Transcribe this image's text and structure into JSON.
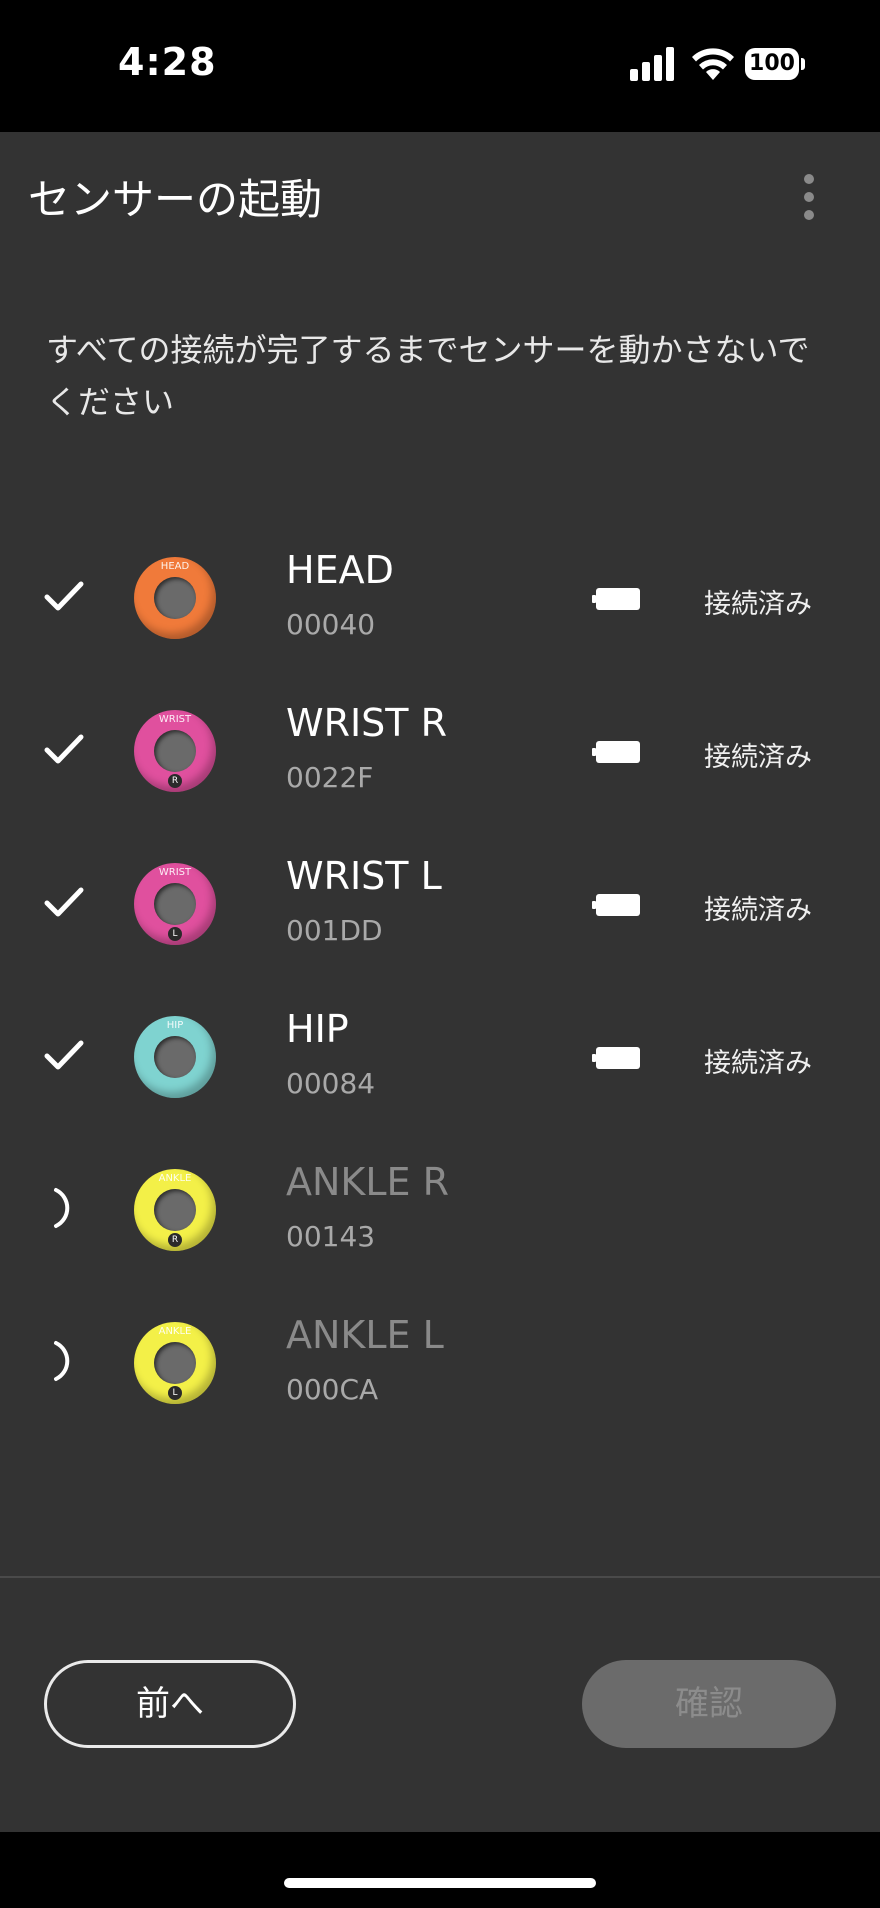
{
  "status_bar": {
    "time": "4:28",
    "battery": "100"
  },
  "header": {
    "title": "センサーの起動"
  },
  "instruction": "すべての接続が完了するまでセンサーを動かさないでください",
  "sensors": [
    {
      "name": "HEAD",
      "serial": "00040",
      "state": "connected",
      "status": "接続済み",
      "badge_text": "HEAD",
      "side": "",
      "color": "#f07a3a"
    },
    {
      "name": "WRIST R",
      "serial": "0022F",
      "state": "connected",
      "status": "接続済み",
      "badge_text": "WRIST",
      "side": "R",
      "color": "#e0509e"
    },
    {
      "name": "WRIST L",
      "serial": "001DD",
      "state": "connected",
      "status": "接続済み",
      "badge_text": "WRIST",
      "side": "L",
      "color": "#e0509e"
    },
    {
      "name": "HIP",
      "serial": "00084",
      "state": "connected",
      "status": "接続済み",
      "badge_text": "HIP",
      "side": "",
      "color": "#7fd3d0"
    },
    {
      "name": "ANKLE R",
      "serial": "00143",
      "state": "connecting",
      "status": "",
      "badge_text": "ANKLE",
      "side": "R",
      "color": "#f3f048"
    },
    {
      "name": "ANKLE L",
      "serial": "000CA",
      "state": "connecting",
      "status": "",
      "badge_text": "ANKLE",
      "side": "L",
      "color": "#f3f048"
    }
  ],
  "footer": {
    "prev_label": "前へ",
    "confirm_label": "確認",
    "confirm_enabled": false
  }
}
